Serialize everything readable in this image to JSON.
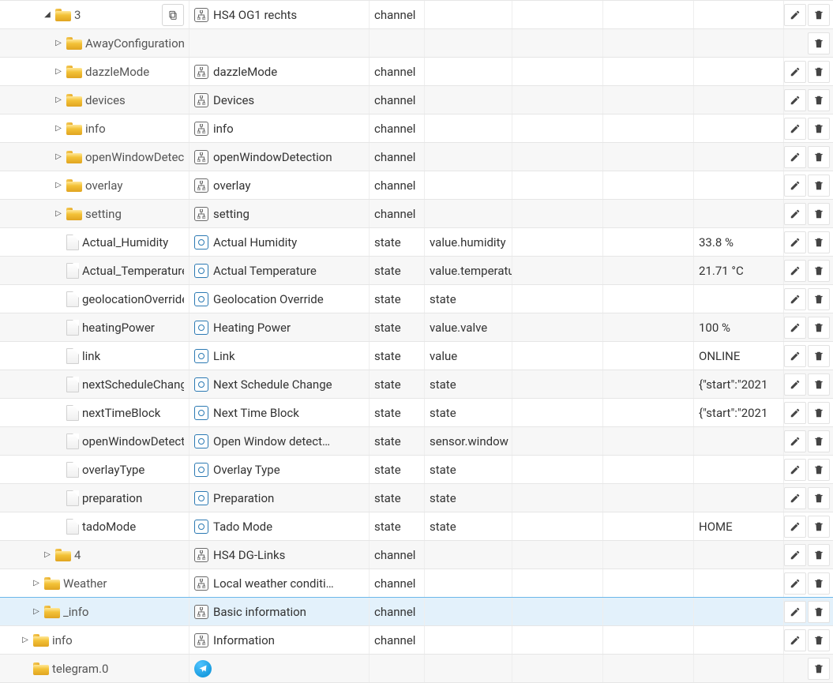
{
  "rows": [
    {
      "indent": 3,
      "expander": "down",
      "icon": "folder",
      "tree_label": "3",
      "show_copy": true,
      "label_black": false,
      "name_icon": "schema",
      "name": "HS4 OG1 rechts",
      "type": "channel",
      "has_edit": true
    },
    {
      "indent": 4,
      "expander": "right",
      "icon": "folder",
      "tree_label": "AwayConfiguration",
      "label_black": false,
      "has_edit": false
    },
    {
      "indent": 4,
      "expander": "right",
      "icon": "folder",
      "tree_label": "dazzleMode",
      "label_black": false,
      "name_icon": "schema",
      "name": "dazzleMode",
      "type": "channel",
      "has_edit": true
    },
    {
      "indent": 4,
      "expander": "right",
      "icon": "folder",
      "tree_label": "devices",
      "label_black": false,
      "name_icon": "schema",
      "name": "Devices",
      "type": "channel",
      "has_edit": true
    },
    {
      "indent": 4,
      "expander": "right",
      "icon": "folder",
      "tree_label": "info",
      "label_black": false,
      "name_icon": "schema",
      "name": "info",
      "type": "channel",
      "has_edit": true
    },
    {
      "indent": 4,
      "expander": "right",
      "icon": "folder",
      "tree_label": "openWindowDetection",
      "label_black": false,
      "name_icon": "schema",
      "name": "openWindowDetection",
      "type": "channel",
      "has_edit": true
    },
    {
      "indent": 4,
      "expander": "right",
      "icon": "folder",
      "tree_label": "overlay",
      "label_black": false,
      "name_icon": "schema",
      "name": "overlay",
      "type": "channel",
      "has_edit": true
    },
    {
      "indent": 4,
      "expander": "right",
      "icon": "folder",
      "tree_label": "setting",
      "label_black": false,
      "name_icon": "schema",
      "name": "setting",
      "type": "channel",
      "has_edit": true
    },
    {
      "indent": 4,
      "expander": "",
      "icon": "file",
      "tree_label": "Actual_Humidity",
      "label_black": true,
      "name_icon": "state",
      "name": "Actual Humidity",
      "type": "state",
      "role": "value.humidity",
      "value": "33.8 %",
      "has_edit": true
    },
    {
      "indent": 4,
      "expander": "",
      "icon": "file",
      "tree_label": "Actual_Temperature",
      "label_black": true,
      "name_icon": "state",
      "name": "Actual Temperature",
      "type": "state",
      "role": "value.temperature",
      "value": "21.71 °C",
      "has_edit": true
    },
    {
      "indent": 4,
      "expander": "",
      "icon": "file",
      "tree_label": "geolocationOverride",
      "label_black": true,
      "name_icon": "state",
      "name": "Geolocation Override",
      "type": "state",
      "role": "state",
      "has_edit": true
    },
    {
      "indent": 4,
      "expander": "",
      "icon": "file",
      "tree_label": "heatingPower",
      "label_black": true,
      "name_icon": "state",
      "name": "Heating Power",
      "type": "state",
      "role": "value.valve",
      "value": "100 %",
      "has_edit": true
    },
    {
      "indent": 4,
      "expander": "",
      "icon": "file",
      "tree_label": "link",
      "label_black": true,
      "name_icon": "state",
      "name": "Link",
      "type": "state",
      "role": "value",
      "value": "ONLINE",
      "has_edit": true
    },
    {
      "indent": 4,
      "expander": "",
      "icon": "file",
      "tree_label": "nextScheduleChange",
      "label_black": true,
      "name_icon": "state",
      "name": "Next Schedule Change",
      "type": "state",
      "role": "state",
      "value": "{\"start\":\"2021",
      "has_edit": true
    },
    {
      "indent": 4,
      "expander": "",
      "icon": "file",
      "tree_label": "nextTimeBlock",
      "label_black": true,
      "name_icon": "state",
      "name": "Next Time Block",
      "type": "state",
      "role": "state",
      "value": "{\"start\":\"2021",
      "has_edit": true
    },
    {
      "indent": 4,
      "expander": "",
      "icon": "file",
      "tree_label": "openWindowDetected",
      "label_black": true,
      "name_icon": "state",
      "name": "Open Window detect…",
      "type": "state",
      "role": "sensor.window",
      "has_edit": true
    },
    {
      "indent": 4,
      "expander": "",
      "icon": "file",
      "tree_label": "overlayType",
      "label_black": true,
      "name_icon": "state",
      "name": "Overlay Type",
      "type": "state",
      "role": "state",
      "has_edit": true
    },
    {
      "indent": 4,
      "expander": "",
      "icon": "file",
      "tree_label": "preparation",
      "label_black": true,
      "name_icon": "state",
      "name": "Preparation",
      "type": "state",
      "role": "state",
      "has_edit": true
    },
    {
      "indent": 4,
      "expander": "",
      "icon": "file",
      "tree_label": "tadoMode",
      "label_black": true,
      "name_icon": "state",
      "name": "Tado Mode",
      "type": "state",
      "role": "state",
      "value": "HOME",
      "has_edit": true
    },
    {
      "indent": 3,
      "expander": "right",
      "icon": "folder",
      "tree_label": "4",
      "label_black": false,
      "name_icon": "schema",
      "name": "HS4 DG-Links",
      "type": "channel",
      "has_edit": true
    },
    {
      "indent": 2,
      "expander": "right",
      "icon": "folder",
      "tree_label": "Weather",
      "label_black": false,
      "name_icon": "schema",
      "name": "Local weather conditi…",
      "type": "channel",
      "has_edit": true
    },
    {
      "indent": 2,
      "expander": "right",
      "icon": "folder",
      "tree_label": "_info",
      "label_black": false,
      "selected": true,
      "name_icon": "schema",
      "name": "Basic information",
      "type": "channel",
      "has_edit": true
    },
    {
      "indent": 1,
      "expander": "right",
      "icon": "folder",
      "tree_label": "info",
      "label_black": false,
      "name_icon": "schema",
      "name": "Information",
      "type": "channel",
      "has_edit": true
    },
    {
      "indent": 1,
      "expander": "",
      "icon": "folder",
      "tree_label": "telegram.0",
      "label_black": false,
      "name_icon": "telegram",
      "has_edit": false
    }
  ],
  "type_display": {
    "channel": "channel",
    "state": "state"
  }
}
